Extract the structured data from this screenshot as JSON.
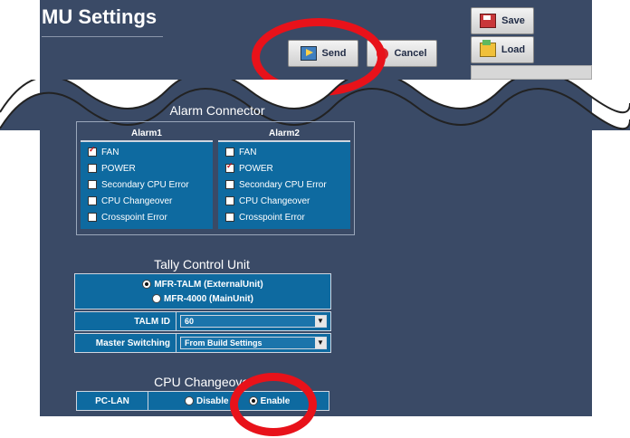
{
  "header": {
    "title": "MU Settings"
  },
  "toolbar": {
    "send_label": "Send",
    "cancel_label": "Cancel",
    "save_label": "Save",
    "load_label": "Load"
  },
  "alarm_connector": {
    "title": "Alarm Connector",
    "alarm1": {
      "header": "Alarm1",
      "items": [
        {
          "label": "FAN",
          "checked": true
        },
        {
          "label": "POWER",
          "checked": false
        },
        {
          "label": "Secondary CPU Error",
          "checked": false
        },
        {
          "label": "CPU Changeover",
          "checked": false
        },
        {
          "label": "Crosspoint Error",
          "checked": false
        }
      ]
    },
    "alarm2": {
      "header": "Alarm2",
      "items": [
        {
          "label": "FAN",
          "checked": false
        },
        {
          "label": "POWER",
          "checked": true
        },
        {
          "label": "Secondary CPU Error",
          "checked": false
        },
        {
          "label": "CPU Changeover",
          "checked": false
        },
        {
          "label": "Crosspoint Error",
          "checked": false
        }
      ]
    }
  },
  "tally": {
    "title": "Tally Control Unit",
    "options": [
      {
        "label": "MFR-TALM (ExternalUnit)",
        "selected": true
      },
      {
        "label": "MFR-4000 (MainUnit)",
        "selected": false
      }
    ],
    "talm_id_label": "TALM ID",
    "talm_id_value": "60",
    "master_switching_label": "Master Switching",
    "master_switching_value": "From Build Settings"
  },
  "cpu_changeover": {
    "title": "CPU Changeover",
    "pclan_label": "PC-LAN",
    "disable_label": "Disable",
    "enable_label": "Enable",
    "enable_selected": true
  },
  "colors": {
    "panel": "#3a4a66",
    "cell": "#0e6aa0",
    "highlight_ring": "#e8121a"
  }
}
